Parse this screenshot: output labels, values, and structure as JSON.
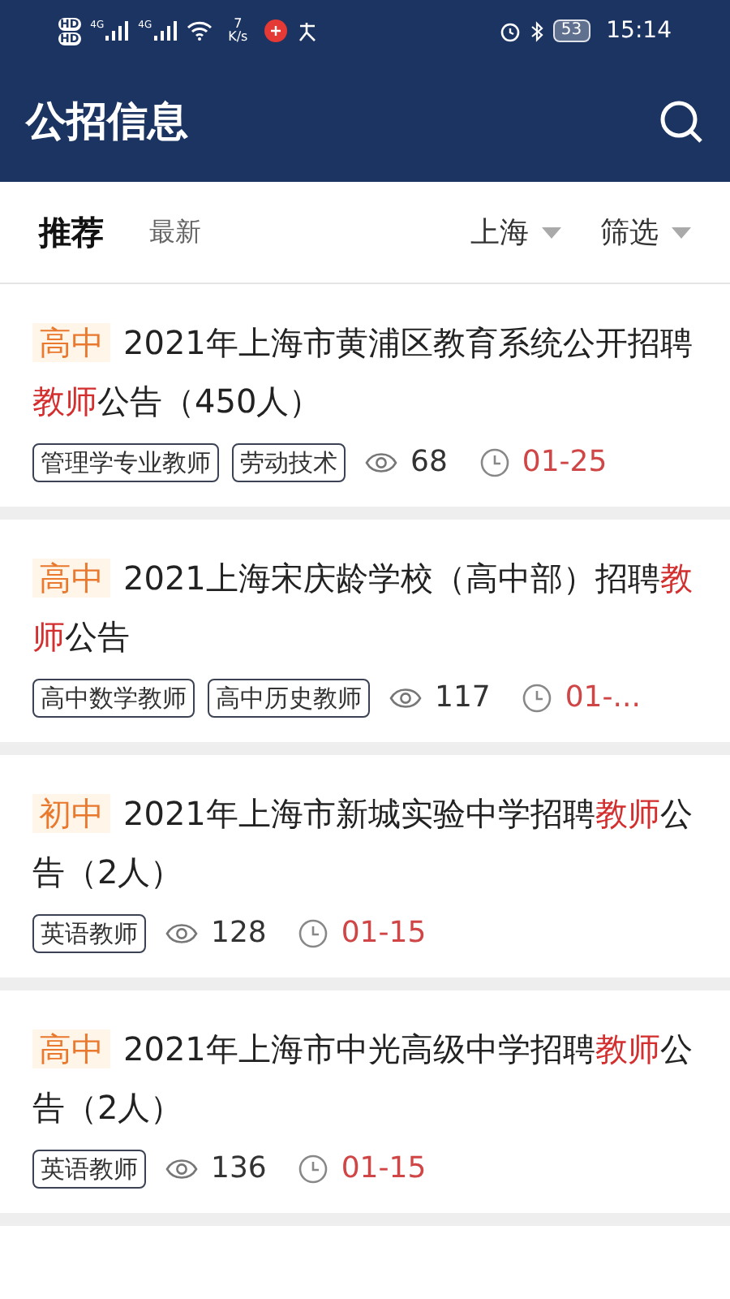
{
  "status_bar": {
    "hd_labels": [
      "HD",
      "HD"
    ],
    "signal_labels": [
      "4G",
      "4G"
    ],
    "speed_value": "7",
    "speed_unit": "K/s",
    "battery": "53",
    "time": "15:14"
  },
  "header": {
    "title": "公招信息"
  },
  "tabs": [
    {
      "label": "推荐",
      "selected": true
    },
    {
      "label": "最新",
      "selected": false
    }
  ],
  "filters": [
    {
      "label": "上海"
    },
    {
      "label": "筛选"
    }
  ],
  "cards": [
    {
      "level": "高中",
      "title_start": "2021年上海市黄浦区教育系统公开招聘",
      "keyword": "教师",
      "title_end": "公告（450人）",
      "tags": [
        "管理学专业教师",
        "劳动技术"
      ],
      "views": "68",
      "date": "01-25"
    },
    {
      "level": "高中",
      "title_start": "2021上海宋庆龄学校（高中部）招聘",
      "keyword": "教师",
      "title_end": "公告",
      "tags": [
        "高中数学教师",
        "高中历史教师"
      ],
      "views": "117",
      "date": "01-..."
    },
    {
      "level": "初中",
      "title_start": "2021年上海市新城实验中学招聘",
      "keyword": "教师",
      "title_end": "公告（2人）",
      "tags": [
        "英语教师"
      ],
      "views": "128",
      "date": "01-15"
    },
    {
      "level": "高中",
      "title_start": "2021年上海市中光高级中学招聘",
      "keyword": "教师",
      "title_end": "公告（2人）",
      "tags": [
        "英语教师"
      ],
      "views": "136",
      "date": "01-15"
    }
  ]
}
